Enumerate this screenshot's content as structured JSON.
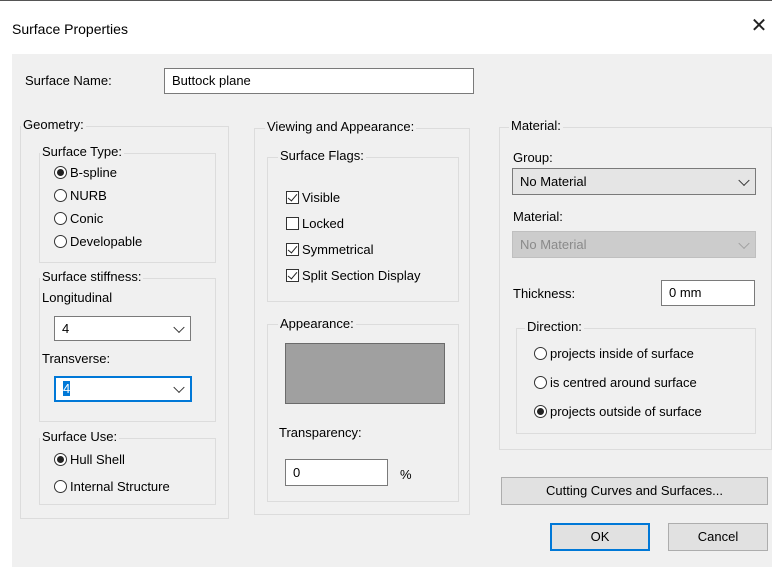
{
  "window": {
    "title": "Surface Properties",
    "close_glyph": "✕"
  },
  "surface_name": {
    "label": "Surface Name:",
    "value": "Buttock plane"
  },
  "geometry": {
    "legend": "Geometry:",
    "surface_type": {
      "legend": "Surface Type:",
      "options": [
        "B-spline",
        "NURB",
        "Conic",
        "Developable"
      ],
      "selected": "B-spline"
    },
    "stiffness": {
      "legend": "Surface stiffness:",
      "longitudinal_label": "Longitudinal",
      "longitudinal_value": "4",
      "transverse_label": "Transverse:",
      "transverse_value": "4"
    },
    "surface_use": {
      "legend": "Surface Use:",
      "options": [
        "Hull Shell",
        "Internal Structure"
      ],
      "selected": "Hull Shell"
    }
  },
  "viewing": {
    "legend": "Viewing and Appearance:",
    "flags": {
      "legend": "Surface Flags:",
      "items": [
        {
          "label": "Visible",
          "checked": true
        },
        {
          "label": "Locked",
          "checked": false
        },
        {
          "label": "Symmetrical",
          "checked": true
        },
        {
          "label": "Split Section Display",
          "checked": true
        }
      ]
    },
    "appearance": {
      "legend": "Appearance:",
      "swatch_color": "#a0a0a0",
      "transparency_label": "Transparency:",
      "transparency_value": "0",
      "transparency_unit": "%"
    }
  },
  "material": {
    "legend": "Material:",
    "group_label": "Group:",
    "group_value": "No Material",
    "material_label": "Material:",
    "material_value": "No Material",
    "thickness_label": "Thickness:",
    "thickness_value": "0 mm",
    "direction": {
      "legend": "Direction:",
      "options": [
        "projects inside of surface",
        "is centred around surface",
        "projects outside of surface"
      ],
      "selected": "projects outside of surface"
    }
  },
  "buttons": {
    "cutting": "Cutting Curves and Surfaces...",
    "ok": "OK",
    "cancel": "Cancel"
  },
  "colors": {
    "accent": "#0078d7",
    "dialog_bg": "#f0f0f0"
  }
}
